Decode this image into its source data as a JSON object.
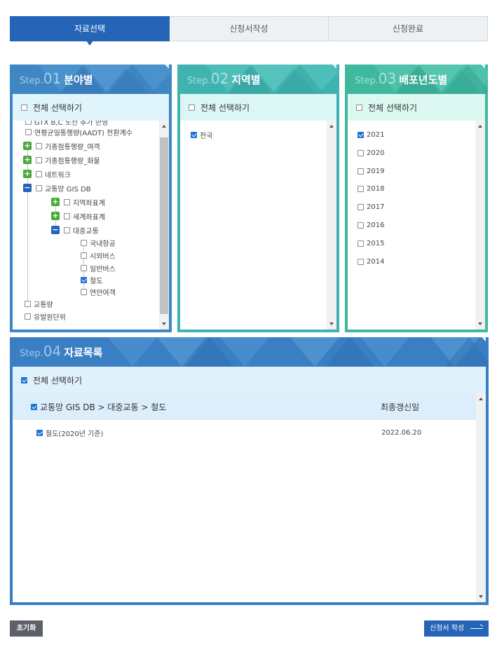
{
  "tabs": [
    {
      "label": "자료선택",
      "active": true
    },
    {
      "label": "신청서작성",
      "active": false
    },
    {
      "label": "신청완료",
      "active": false
    }
  ],
  "step1": {
    "step": "Step.",
    "num": "01",
    "title": "분야별",
    "select_all": "전체 선택하기",
    "items": [
      {
        "label": "GTX B,C 노선 추가 반영",
        "checked": false
      },
      {
        "label": "연평균일통행량(AADT) 전환계수",
        "checked": false
      },
      {
        "label": "기종점통행량_여객",
        "checked": false,
        "toggle": "+"
      },
      {
        "label": "기종점통행량_화물",
        "checked": false,
        "toggle": "+"
      },
      {
        "label": "네트워크",
        "checked": false,
        "toggle": "+"
      },
      {
        "label": "교통망 GIS DB",
        "checked": false,
        "toggle": "−"
      },
      {
        "label": "지역좌표계",
        "checked": false,
        "toggle": "+"
      },
      {
        "label": "세계좌표계",
        "checked": false,
        "toggle": "+"
      },
      {
        "label": "대중교통",
        "checked": false,
        "toggle": "−"
      },
      {
        "label": "국내항공",
        "checked": false
      },
      {
        "label": "시외버스",
        "checked": false
      },
      {
        "label": "일반버스",
        "checked": false
      },
      {
        "label": "철도",
        "checked": true
      },
      {
        "label": "연안여객",
        "checked": false
      },
      {
        "label": "교통량",
        "checked": false
      },
      {
        "label": "유발원단위",
        "checked": false
      }
    ]
  },
  "step2": {
    "step": "Step.",
    "num": "02",
    "title": "지역별",
    "select_all": "전체 선택하기",
    "items": [
      {
        "label": "전국",
        "checked": true
      }
    ]
  },
  "step3": {
    "step": "Step.",
    "num": "03",
    "title": "배포년도별",
    "select_all": "전체 선택하기",
    "items": [
      {
        "label": "2021",
        "checked": true
      },
      {
        "label": "2020",
        "checked": false
      },
      {
        "label": "2019",
        "checked": false
      },
      {
        "label": "2018",
        "checked": false
      },
      {
        "label": "2017",
        "checked": false
      },
      {
        "label": "2016",
        "checked": false
      },
      {
        "label": "2015",
        "checked": false
      },
      {
        "label": "2014",
        "checked": false
      }
    ]
  },
  "step4": {
    "step": "Step.",
    "num": "04",
    "title": "자료목록",
    "select_all": "전체 선택하기",
    "group_path": "교통망 GIS DB > 대중교통 > 철도",
    "date_header": "최종갱신일",
    "rows": [
      {
        "label": "철도(2020년 기준)",
        "date": "2022.06.20",
        "checked": true
      }
    ]
  },
  "buttons": {
    "reset": "초기화",
    "next": "신청서 작성"
  },
  "colors": {
    "primary": "#2565b8",
    "step1": "#3f86c4",
    "step2": "#3fb3b0",
    "step3": "#3fb8a0",
    "step4": "#3a7fc4",
    "toggle_plus": "#4aa83c"
  }
}
